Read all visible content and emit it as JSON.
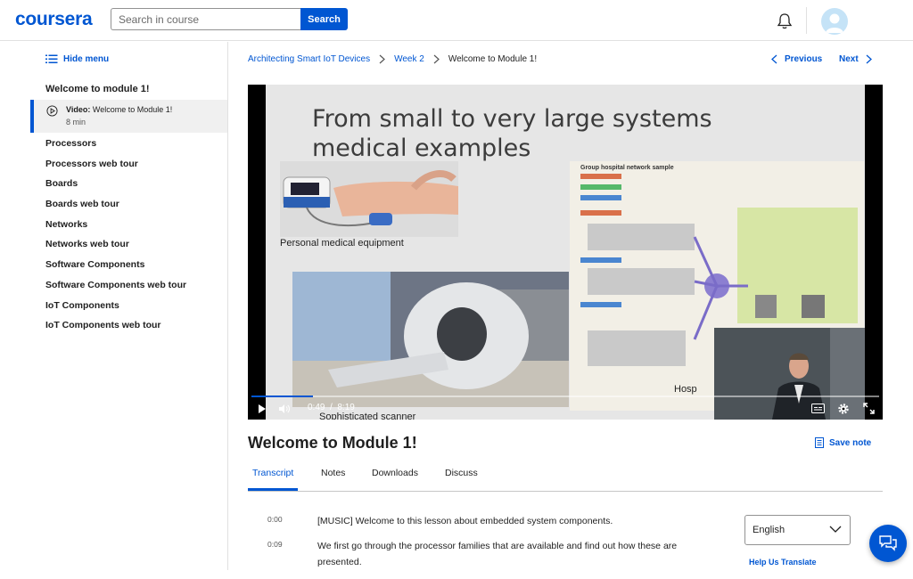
{
  "header": {
    "logo": "coursera",
    "search_placeholder": "Search in course",
    "search_button": "Search"
  },
  "sidebar": {
    "hide_menu": "Hide menu",
    "module_title": "Welcome to module 1!",
    "active_item": {
      "type": "Video:",
      "title": "Welcome to Module 1!",
      "duration": "8 min"
    },
    "items": [
      "Processors",
      "Processors web tour",
      "Boards",
      "Boards web tour",
      "Networks",
      "Networks web tour",
      "Software Components",
      "Software Components web tour",
      "IoT Components",
      "IoT Components web tour"
    ]
  },
  "breadcrumb": [
    "Architecting Smart IoT Devices",
    "Week 2",
    "Welcome to Module 1!"
  ],
  "nav": {
    "previous": "Previous",
    "next": "Next"
  },
  "video": {
    "slide_title_line1": "From small to very large systems",
    "slide_title_line2": "medical examples",
    "caption_equipment": "Personal medical equipment",
    "caption_scanner": "Sophisticated scanner",
    "caption_hospital": "Hosp",
    "diagram_title": "Group hospital network sample",
    "current_time": "0:49",
    "duration": "8:19",
    "progress": 0.098
  },
  "lesson": {
    "title": "Welcome to Module 1!",
    "save_note": "Save note"
  },
  "tabs": [
    "Transcript",
    "Notes",
    "Downloads",
    "Discuss"
  ],
  "transcript": [
    {
      "time": "0:00",
      "text": "[MUSIC] Welcome to this lesson about embedded system components."
    },
    {
      "time": "0:09",
      "text": "We first go through the processor families that are available and find out how these are presented."
    }
  ],
  "language": {
    "selected": "English",
    "help": "Help Us Translate"
  },
  "colors": {
    "brand": "#0056d2"
  }
}
